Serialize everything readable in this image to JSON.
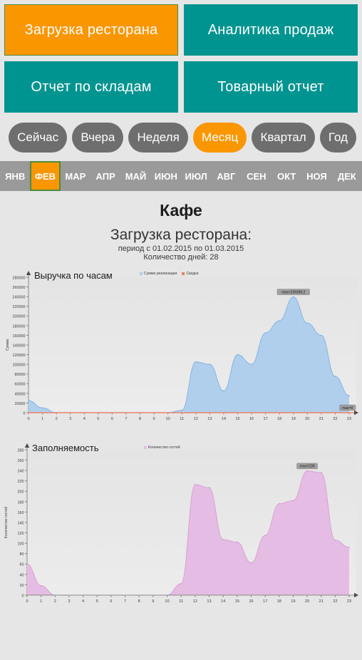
{
  "tiles": [
    {
      "label": "Загрузка ресторана",
      "active": true
    },
    {
      "label": "Аналитика продаж",
      "active": false
    },
    {
      "label": "Отчет по складам",
      "active": false
    },
    {
      "label": "Товарный отчет",
      "active": false
    }
  ],
  "periods": [
    {
      "label": "Сейчас",
      "active": false
    },
    {
      "label": "Вчера",
      "active": false
    },
    {
      "label": "Неделя",
      "active": false
    },
    {
      "label": "Месяц",
      "active": true
    },
    {
      "label": "Квартал",
      "active": false
    },
    {
      "label": "Год",
      "active": false
    }
  ],
  "months": [
    {
      "label": "ЯНВ",
      "active": false
    },
    {
      "label": "ФЕВ",
      "active": true
    },
    {
      "label": "МАР",
      "active": false
    },
    {
      "label": "АПР",
      "active": false
    },
    {
      "label": "МАЙ",
      "active": false
    },
    {
      "label": "ИЮН",
      "active": false
    },
    {
      "label": "ИЮЛ",
      "active": false
    },
    {
      "label": "АВГ",
      "active": false
    },
    {
      "label": "СЕН",
      "active": false
    },
    {
      "label": "ОКТ",
      "active": false
    },
    {
      "label": "НОЯ",
      "active": false
    },
    {
      "label": "ДЕК",
      "active": false
    }
  ],
  "header": {
    "shop_name": "Кафе",
    "report_name": "Загрузка ресторана:",
    "period_line": "период с 01.02.2015 по 01.03.2015",
    "days_line": "Количество дней: 28"
  },
  "colors": {
    "orange": "#fa9600",
    "teal": "#009490",
    "grey_pill": "#6e6e6e",
    "grey_bar": "#9a9a9a",
    "page_bg": "#e6e6e6",
    "active_border": "#4c8c3f",
    "revenue_fill": "#b0cfec",
    "revenue_line": "#7fb2e0",
    "discount_line": "#e8836a",
    "guests_fill": "#e5bce3",
    "guests_line": "#d69fd2",
    "axis": "#8a8a8a",
    "plot_bg_top": "#e4e4e4",
    "plot_bg_bottom": "#ececec"
  },
  "chart_data": [
    {
      "type": "area",
      "title": "Выручка по часам",
      "xlabel": "",
      "ylabel": "Сумма",
      "xlim": [
        0,
        23
      ],
      "ylim": [
        0,
        280000
      ],
      "ytick_step": 20000,
      "yticks": [
        0,
        20000,
        40000,
        60000,
        80000,
        100000,
        120000,
        140000,
        160000,
        180000,
        200000,
        220000,
        240000,
        260000,
        280000
      ],
      "x": [
        0,
        1,
        2,
        3,
        4,
        5,
        6,
        7,
        8,
        9,
        10,
        11,
        12,
        13,
        14,
        15,
        16,
        17,
        18,
        19,
        20,
        21,
        22,
        23
      ],
      "xticks": [
        "0",
        "1",
        "2",
        "3",
        "4",
        "5",
        "6",
        "7",
        "8",
        "9",
        "10",
        "11",
        "12",
        "13",
        "14",
        "15",
        "16",
        "17",
        "18",
        "19",
        "20",
        "21",
        "22",
        "23"
      ],
      "grid": false,
      "legend_position": "top-center",
      "series": [
        {
          "name": "Сумма реализации",
          "color": "#b0cfec",
          "values": [
            25000,
            10000,
            0,
            0,
            0,
            0,
            0,
            0,
            0,
            0,
            0,
            5000,
            105000,
            100000,
            45000,
            120000,
            100000,
            165000,
            190000,
            239309.2,
            185000,
            160000,
            75000,
            35000
          ],
          "annotation": "max=239309.2",
          "annotation_x": 19
        },
        {
          "name": "Скидка",
          "color": "#e8836a",
          "values": [
            0,
            0,
            0,
            0,
            0,
            0,
            0,
            0,
            0,
            0,
            0,
            0,
            0,
            0,
            0,
            0,
            0,
            0,
            0,
            0,
            0,
            0,
            0,
            0
          ],
          "annotation": "max=0",
          "annotation_x": 23
        }
      ]
    },
    {
      "type": "area",
      "title": "Заполняемость",
      "xlabel": "",
      "ylabel": "Количество гостей",
      "xlim": [
        0,
        23
      ],
      "ylim": [
        0,
        280
      ],
      "ytick_step": 20,
      "yticks": [
        0,
        20,
        40,
        60,
        80,
        100,
        120,
        140,
        160,
        180,
        200,
        220,
        240,
        260,
        280
      ],
      "x": [
        0,
        1,
        2,
        3,
        4,
        5,
        6,
        7,
        8,
        9,
        10,
        11,
        12,
        13,
        14,
        15,
        16,
        17,
        18,
        19,
        20,
        21,
        22,
        23
      ],
      "xticks": [
        "0",
        "1",
        "2",
        "3",
        "4",
        "5",
        "6",
        "7",
        "8",
        "9",
        "10",
        "11",
        "12",
        "13",
        "14",
        "15",
        "16",
        "17",
        "18",
        "19",
        "20",
        "21",
        "22",
        "23"
      ],
      "grid": false,
      "legend_position": "top-center",
      "series": [
        {
          "name": "Количество гостей",
          "color": "#e5bce3",
          "values": [
            60,
            18,
            0,
            0,
            0,
            0,
            0,
            0,
            0,
            0,
            0,
            22,
            213,
            207,
            107,
            102,
            62,
            115,
            176,
            182,
            239,
            236,
            106,
            92
          ],
          "annotation": "max=239",
          "annotation_x": 20
        }
      ]
    }
  ]
}
